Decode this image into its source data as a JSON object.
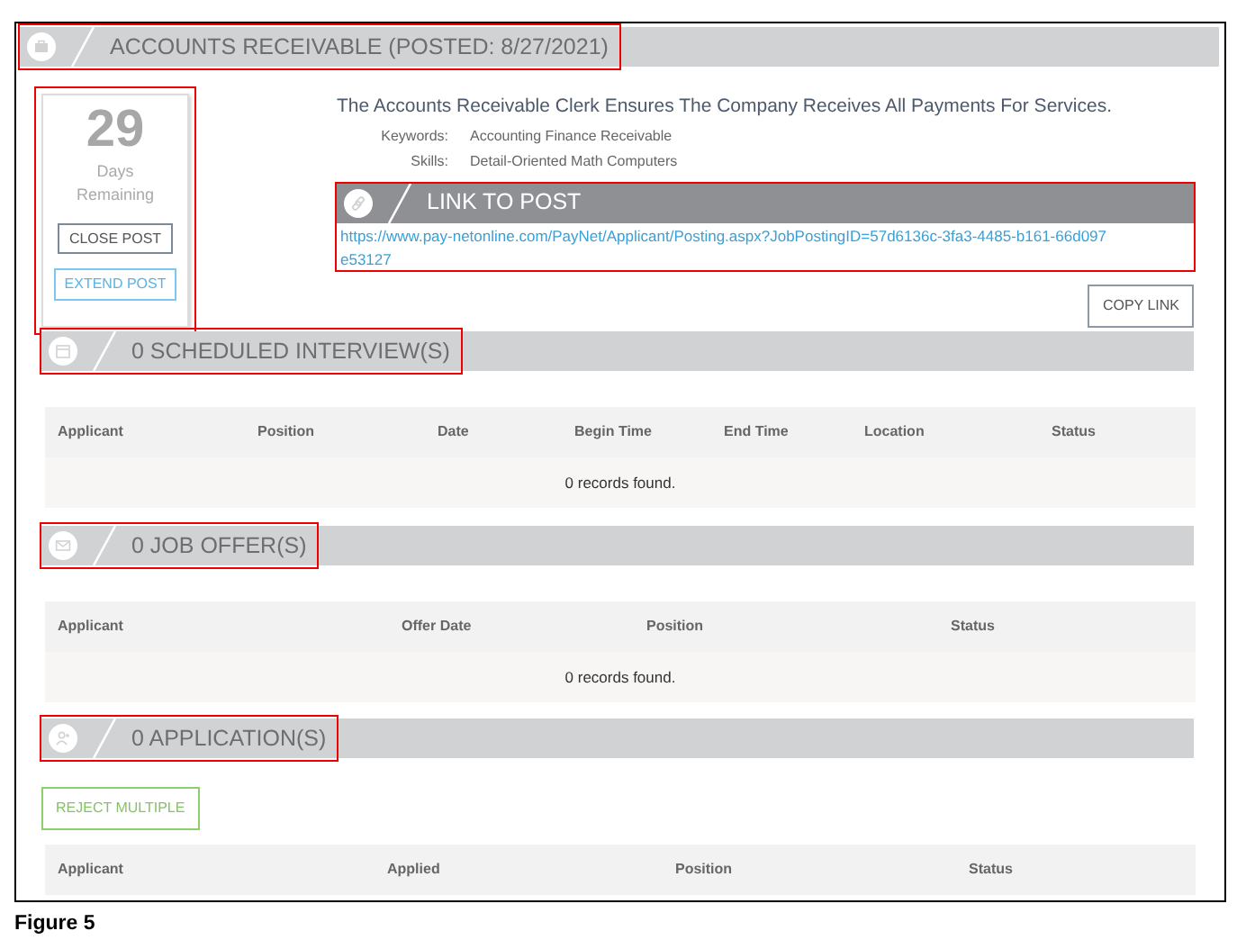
{
  "post": {
    "title": "ACCOUNTS RECEIVABLE (POSTED: 8/27/2021)",
    "highlighted": true
  },
  "countdown": {
    "number": "29",
    "unit": "Days",
    "caption": "Remaining",
    "highlighted": true
  },
  "post_buttons": [
    {
      "label": "CLOSE POST",
      "kind": "dark"
    },
    {
      "label": "EXTEND POST",
      "kind": "info"
    }
  ],
  "description": "The Accounts Receivable Clerk Ensures The Company Receives All Payments For Services.",
  "details": [
    {
      "label": "Keywords:",
      "value": "Accounting Finance Receivable"
    },
    {
      "label": "Skills:",
      "value": "Detail-Oriented Math Computers"
    }
  ],
  "link_panel": {
    "title": "LINK TO POST",
    "url": "https://www.pay-netonline.com/PayNet/Applicant/Posting.aspx?JobPostingID=57d6136c-3fa3-4485-b161-66d097e53127",
    "highlighted": true
  },
  "copy_button": "COPY LINK",
  "sections": [
    {
      "title": "0 SCHEDULED INTERVIEW(S)",
      "kind": "calendar",
      "highlighted": true,
      "columns": [
        "Applicant",
        "Position",
        "Date",
        "Begin Time",
        "End Time",
        "Location",
        "Status"
      ],
      "empty_text": "0 records found."
    },
    {
      "title": "0 JOB OFFER(S)",
      "kind": "envelope",
      "highlighted": true,
      "columns": [
        "Applicant",
        "Offer Date",
        "Position",
        "Status"
      ],
      "empty_text": "0 records found."
    },
    {
      "title": "0 APPLICATION(S)",
      "kind": "person",
      "highlighted": true,
      "action_button": "REJECT MULTIPLE",
      "columns": [
        "Applicant",
        "Applied",
        "Position",
        "Status"
      ]
    }
  ],
  "caption": "Figure 5"
}
